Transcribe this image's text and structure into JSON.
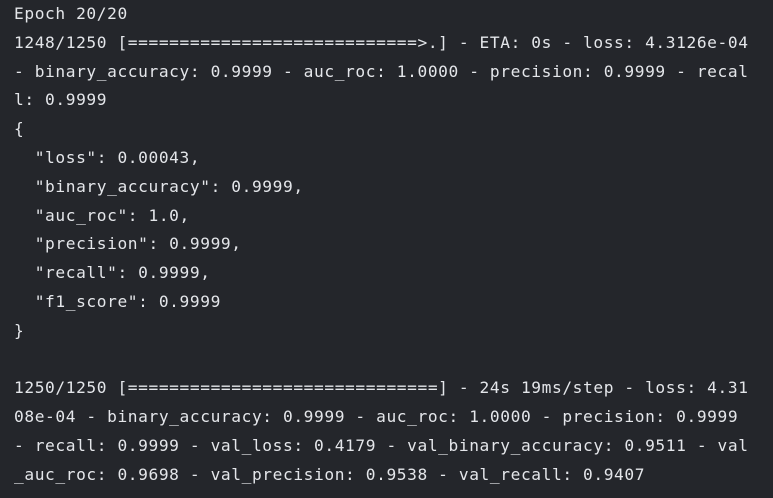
{
  "terminal": {
    "lines": [
      "Epoch 20/20",
      "1248/1250 [============================>.] - ETA: 0s - loss: 4.3126e-04",
      "- binary_accuracy: 0.9999 - auc_roc: 1.0000 - precision: 0.9999 - recal",
      "l: 0.9999",
      "{",
      "  \"loss\": 0.00043,",
      "  \"binary_accuracy\": 0.9999,",
      "  \"auc_roc\": 1.0,",
      "  \"precision\": 0.9999,",
      "  \"recall\": 0.9999,",
      "  \"f1_score\": 0.9999",
      "}",
      "",
      "1250/1250 [==============================] - 24s 19ms/step - loss: 4.31",
      "08e-04 - binary_accuracy: 0.9999 - auc_roc: 1.0000 - precision: 0.9999",
      "- recall: 0.9999 - val_loss: 0.4179 - val_binary_accuracy: 0.9511 - val",
      "_auc_roc: 0.9698 - val_precision: 0.9538 - val_recall: 0.9407"
    ]
  }
}
